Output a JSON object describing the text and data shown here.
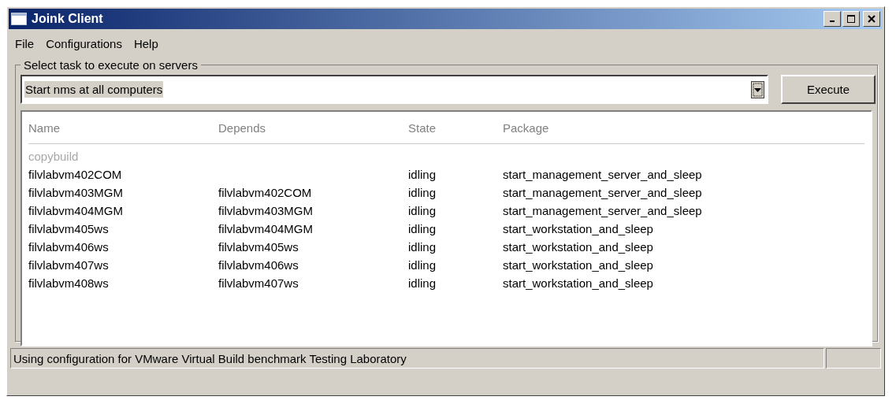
{
  "window": {
    "title": "Joink Client"
  },
  "menu": [
    "File",
    "Configurations",
    "Help"
  ],
  "task_group": {
    "label": "Select task to execute on servers",
    "task_dropdown": {
      "value": "Start nms at all computers"
    },
    "execute_button": "Execute"
  },
  "table": {
    "columns": [
      "Name",
      "Depends",
      "State",
      "Package"
    ],
    "rows": [
      {
        "cells": [
          "copybuild",
          "",
          "",
          ""
        ],
        "disabled": true
      },
      {
        "cells": [
          "filvlabvm402COM",
          "",
          "idling",
          "start_management_server_and_sleep"
        ],
        "disabled": false
      },
      {
        "cells": [
          "filvlabvm403MGM",
          "filvlabvm402COM",
          "idling",
          "start_management_server_and_sleep"
        ],
        "disabled": false
      },
      {
        "cells": [
          "filvlabvm404MGM",
          "filvlabvm403MGM",
          "idling",
          "start_management_server_and_sleep"
        ],
        "disabled": false
      },
      {
        "cells": [
          "filvlabvm405ws",
          "filvlabvm404MGM",
          "idling",
          "start_workstation_and_sleep"
        ],
        "disabled": false
      },
      {
        "cells": [
          "filvlabvm406ws",
          "filvlabvm405ws",
          "idling",
          "start_workstation_and_sleep"
        ],
        "disabled": false
      },
      {
        "cells": [
          "filvlabvm407ws",
          "filvlabvm406ws",
          "idling",
          "start_workstation_and_sleep"
        ],
        "disabled": false
      },
      {
        "cells": [
          "filvlabvm408ws",
          "filvlabvm407ws",
          "idling",
          "start_workstation_and_sleep"
        ],
        "disabled": false
      }
    ]
  },
  "status_bar": "Using configuration for VMware Virtual Build benchmark Testing Laboratory"
}
